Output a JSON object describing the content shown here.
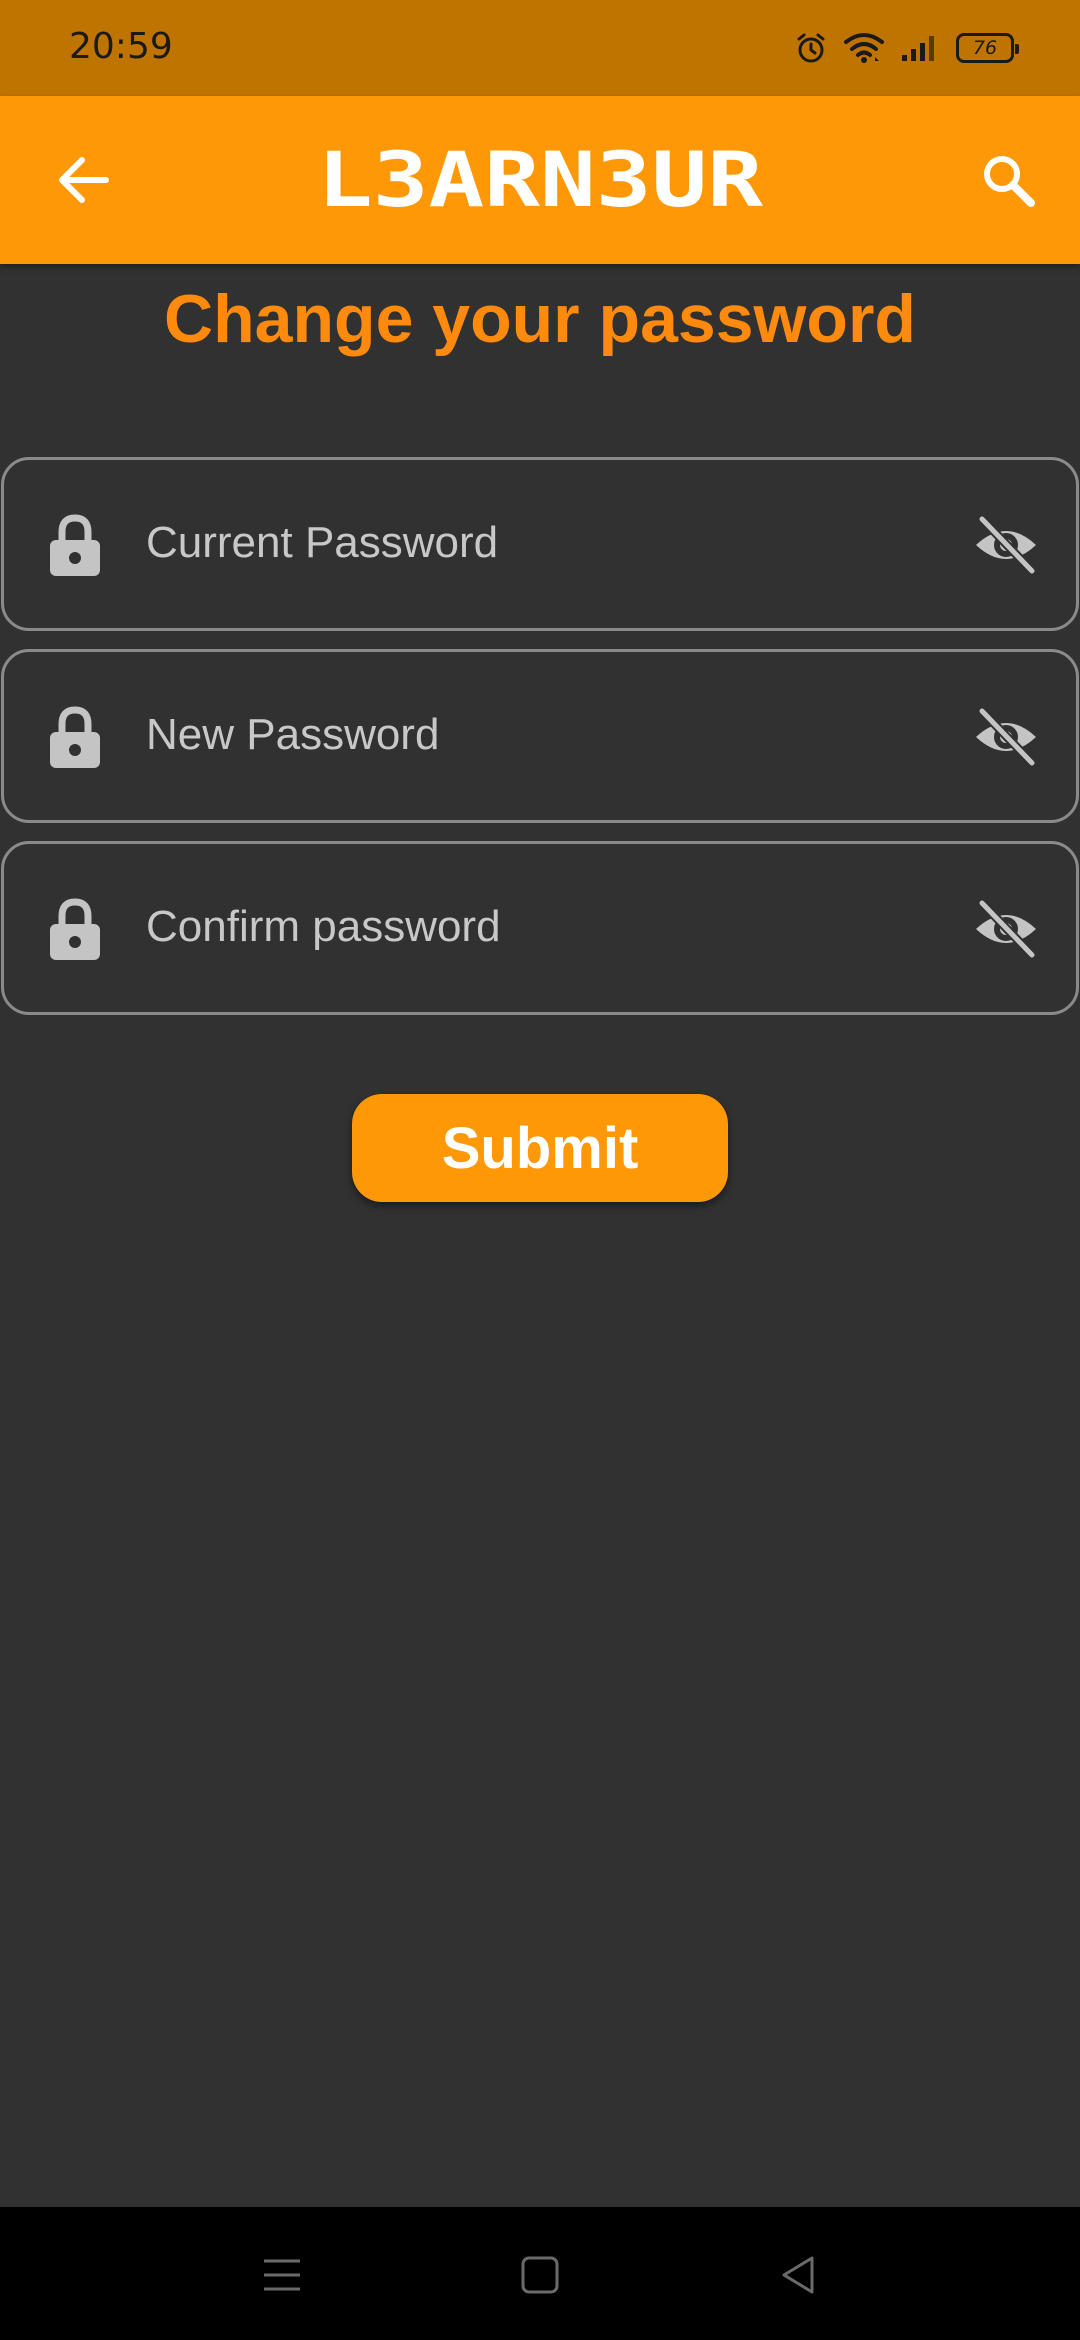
{
  "status_bar": {
    "time": "20:59",
    "battery": "76",
    "icons": [
      "alarm-icon",
      "wifi-icon",
      "signal-icon",
      "battery-icon"
    ]
  },
  "app_bar": {
    "logo_text": "L3ARN3UR",
    "back_icon": "arrow-left-icon",
    "search_icon": "search-icon"
  },
  "page": {
    "title": "Change your password"
  },
  "fields": [
    {
      "label": "Current Password",
      "leading_icon": "lock-icon",
      "trailing_icon": "visibility-off-icon"
    },
    {
      "label": "New Password",
      "leading_icon": "lock-icon",
      "trailing_icon": "visibility-off-icon"
    },
    {
      "label": "Confirm password",
      "leading_icon": "lock-icon",
      "trailing_icon": "visibility-off-icon"
    }
  ],
  "submit": {
    "label": "Submit"
  },
  "nav_bar": {
    "buttons": [
      "menu-icon",
      "home-icon",
      "back-triangle-icon"
    ]
  },
  "colors": {
    "status_bar": "#C07400",
    "app_bar": "#FF9806",
    "title": "#FF8A0E",
    "background": "#313131",
    "field_border": "#8a8a8a",
    "nav_bar": "#000000"
  }
}
